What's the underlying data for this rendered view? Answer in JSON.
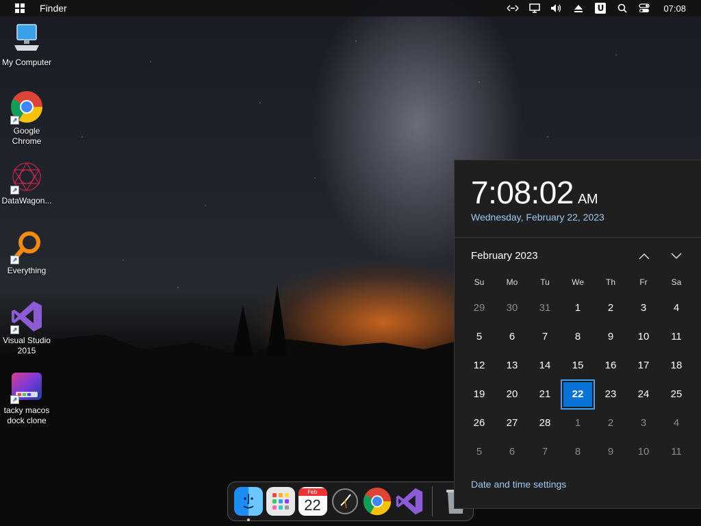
{
  "topbar": {
    "app_name": "Finder",
    "time": "07:08",
    "tray_icons": [
      "network-arrows-icon",
      "display-icon",
      "volume-icon",
      "eject-icon",
      "u-app-icon",
      "search-icon",
      "control-center-icon"
    ],
    "u_label": "U"
  },
  "desktop": {
    "icons": [
      {
        "label": "My Computer",
        "icon": "computer-icon"
      },
      {
        "label": "Google Chrome",
        "icon": "chrome-icon"
      },
      {
        "label": "DataWagon...",
        "icon": "datawagon-icon"
      },
      {
        "label": "Everything",
        "icon": "everything-search-icon"
      },
      {
        "label": "Visual Studio 2015",
        "icon": "visual-studio-icon"
      },
      {
        "label": "tacky macos dock clone",
        "icon": "dock-clone-icon"
      }
    ]
  },
  "dock": {
    "items": [
      "finder-icon",
      "launchpad-icon",
      "calendar-icon",
      "clock-icon",
      "chrome-icon",
      "visual-studio-icon",
      "trash-icon"
    ],
    "calendar_month": "Feb",
    "calendar_day": "22"
  },
  "calendar": {
    "time": "7:08:02",
    "ampm": "AM",
    "date_long": "Wednesday, February 22, 2023",
    "month_title": "February 2023",
    "weekdays": [
      "Su",
      "Mo",
      "Tu",
      "We",
      "Th",
      "Fr",
      "Sa"
    ],
    "weeks": [
      [
        "29",
        "30",
        "31",
        "1",
        "2",
        "3",
        "4"
      ],
      [
        "5",
        "6",
        "7",
        "8",
        "9",
        "10",
        "11"
      ],
      [
        "12",
        "13",
        "14",
        "15",
        "16",
        "17",
        "18"
      ],
      [
        "19",
        "20",
        "21",
        "22",
        "23",
        "24",
        "25"
      ],
      [
        "26",
        "27",
        "28",
        "1",
        "2",
        "3",
        "4"
      ],
      [
        "5",
        "6",
        "7",
        "8",
        "9",
        "10",
        "11"
      ]
    ],
    "today": "22",
    "settings_link": "Date and time settings"
  },
  "colors": {
    "accent": "#0a74d6",
    "link": "#9ec8f0",
    "flyout_bg": "#1f1f1f"
  }
}
